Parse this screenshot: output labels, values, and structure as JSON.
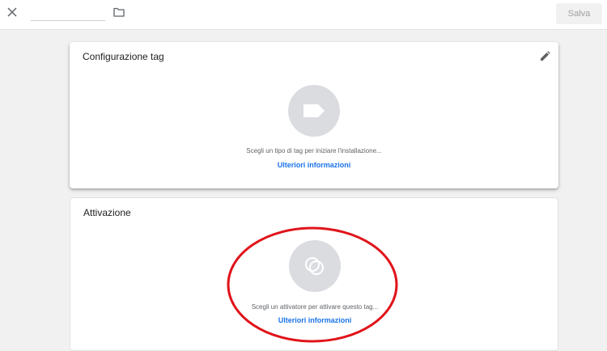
{
  "header": {
    "tag_name_value": "",
    "tag_name_placeholder": "",
    "save_label": "Salva"
  },
  "icons": {
    "close": "close-icon",
    "folder": "folder-icon",
    "edit": "pencil-icon",
    "tag": "tag-icon",
    "trigger": "trigger-icon"
  },
  "config_card": {
    "title": "Configurazione tag",
    "hint": "Scegli un tipo di tag per iniziare l'installazione...",
    "link": "Ulteriori informazioni"
  },
  "trigger_card": {
    "title": "Attivazione",
    "hint": "Scegli un attivatore per attivare questo tag...",
    "link": "Ulteriori informazioni"
  },
  "colors": {
    "accent": "#1a73e8",
    "annotation": "#e0141a",
    "placeholder_circle": "#dadce0"
  }
}
